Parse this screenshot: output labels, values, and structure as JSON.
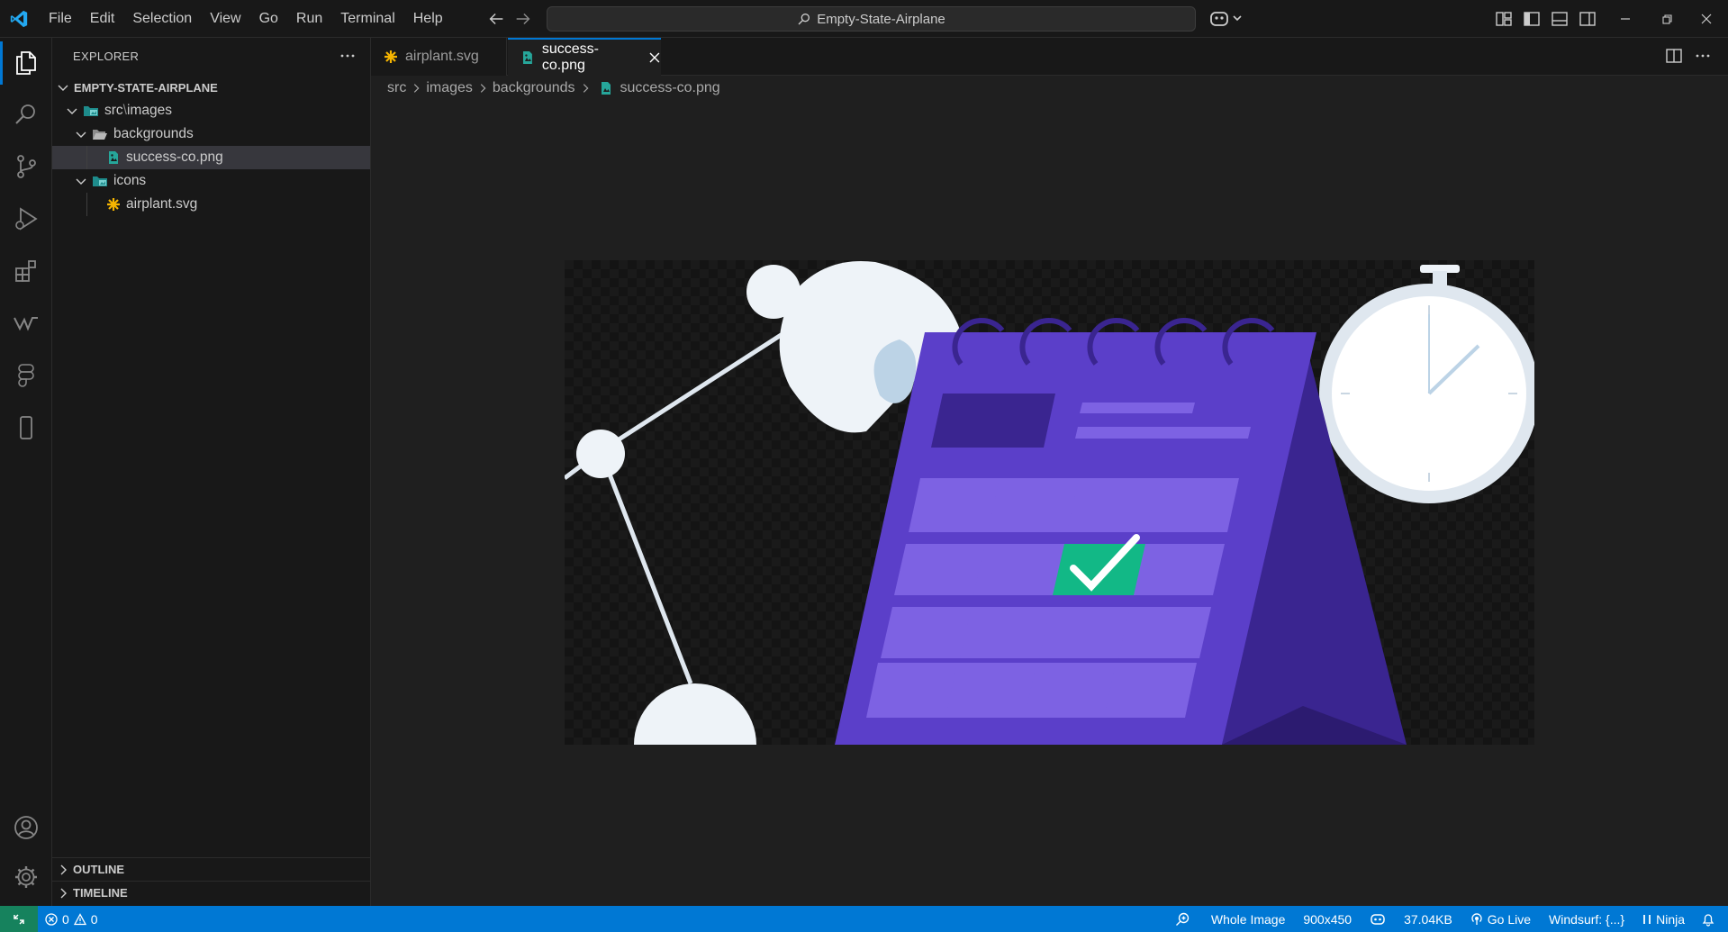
{
  "titlebar": {
    "menu": [
      "File",
      "Edit",
      "Selection",
      "View",
      "Go",
      "Run",
      "Terminal",
      "Help"
    ],
    "search_text": "Empty-State-Airplane"
  },
  "explorer": {
    "title": "EXPLORER",
    "project": "EMPTY-STATE-AIRPLANE",
    "tree": {
      "src_images": "src",
      "src_images_sep": "\\",
      "src_images_rest": "images",
      "backgrounds": "backgrounds",
      "success_file": "success-co.png",
      "icons": "icons",
      "airplant_file": "airplant.svg"
    },
    "outline": "OUTLINE",
    "timeline": "TIMELINE"
  },
  "tabs": [
    {
      "label": "airplant.svg",
      "active": false
    },
    {
      "label": "success-co.png",
      "active": true
    }
  ],
  "breadcrumb": [
    "src",
    "images",
    "backgrounds",
    "success-co.png"
  ],
  "statusbar": {
    "errors": "0",
    "warnings": "0",
    "zoom": "Whole Image",
    "dimensions": "900x450",
    "size": "37.04KB",
    "go_live": "Go Live",
    "windsurf": "Windsurf: {...}",
    "ninja": "Ninja"
  },
  "colors": {
    "accent": "#0078d4",
    "remote": "#16825d",
    "calendar_purple": "#5b3fc9",
    "checkmark_green": "#12b886"
  }
}
